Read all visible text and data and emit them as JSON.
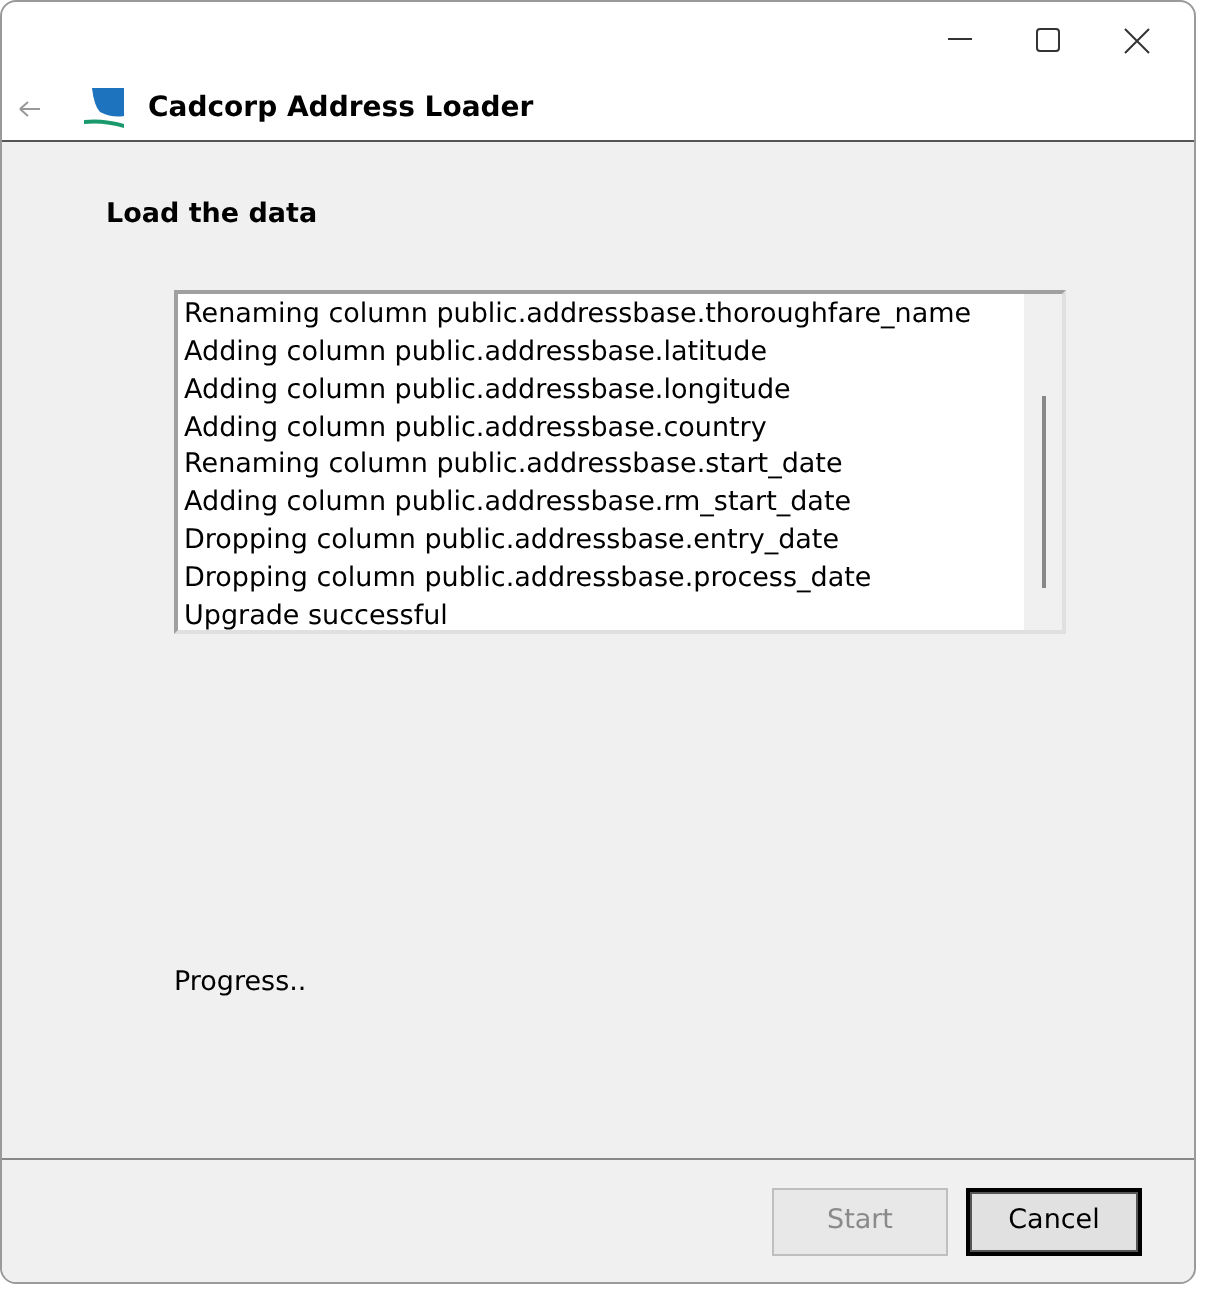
{
  "window": {
    "title": "Cadcorp Address Loader"
  },
  "page": {
    "heading": "Load the data"
  },
  "log": {
    "lines": [
      "Renaming column public.addressbase.thoroughfare_name",
      "Adding column public.addressbase.latitude",
      "Adding column public.addressbase.longitude",
      "Adding column public.addressbase.country",
      "Renaming column public.addressbase.start_date",
      "Adding column public.addressbase.rm_start_date",
      "Dropping column public.addressbase.entry_date",
      "Dropping column public.addressbase.process_date",
      "Upgrade successful"
    ]
  },
  "progress": {
    "label": "Progress.."
  },
  "buttons": [
    {
      "label": "Start",
      "disabled": true,
      "default": false
    },
    {
      "label": "Cancel",
      "disabled": false,
      "default": true
    }
  ]
}
